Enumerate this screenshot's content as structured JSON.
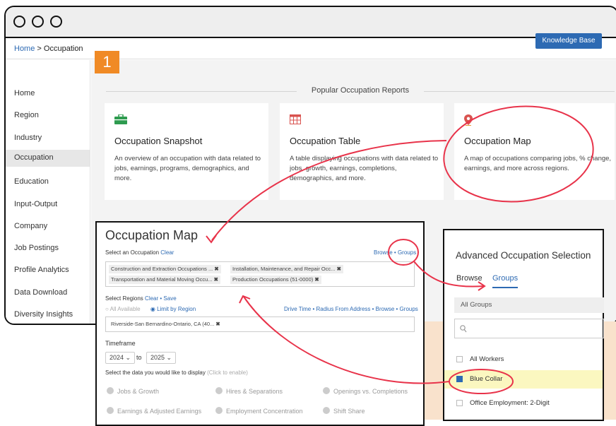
{
  "breadcrumb": {
    "home": "Home",
    "separator": ">",
    "current": "Occupation"
  },
  "header": {
    "knowledge_base": "Knowledge Base"
  },
  "step_badge": "1",
  "sidebar": {
    "items": [
      {
        "label": "Home"
      },
      {
        "label": "Region"
      },
      {
        "label": "Industry"
      },
      {
        "label": "Occupation"
      },
      {
        "label": "Education"
      },
      {
        "label": "Input-Output"
      },
      {
        "label": "Company"
      },
      {
        "label": "Job Postings"
      },
      {
        "label": "Profile Analytics"
      },
      {
        "label": "Data Download"
      },
      {
        "label": "Diversity Insights"
      }
    ],
    "active": "Occupation"
  },
  "popular": {
    "title": "Popular Occupation Reports",
    "cards": [
      {
        "icon": "briefcase-icon",
        "title": "Occupation Snapshot",
        "desc": "An overview of an occupation with data related to jobs, earnings, programs, demographics, and more."
      },
      {
        "icon": "table-icon",
        "title": "Occupation Table",
        "desc": "A table displaying occupations with data related to jobs, growth, earnings, completions, demographics, and more."
      },
      {
        "icon": "map-pin-icon",
        "title": "Occupation Map",
        "desc": "A map of occupations comparing jobs, % change, earnings, and more across regions."
      }
    ]
  },
  "map_panel": {
    "title": "Occupation Map",
    "select_occupation": "Select an Occupation",
    "clear": "Clear",
    "browse": "Browse",
    "groups": "Groups",
    "tags": [
      "Construction and Extraction Occupations ...",
      "Installation, Maintenance, and Repair Occ...",
      "Transportation and Material Moving Occu...",
      "Production Occupations (51-0000)"
    ],
    "select_regions": "Select Regions",
    "clear_save": "Clear • Save",
    "all_available": "All Available",
    "limit_by_region": "Limit by Region",
    "region_links": "Drive Time • Radius From Address • Browse • Groups",
    "region_tag": "Riverside-San Bernardino-Ontario, CA (40...",
    "timeframe": "Timeframe",
    "year_from": "2024",
    "to": "to",
    "year_to": "2025",
    "data_prompt": "Select the data you would like to display",
    "click_enable": "(Click to enable)",
    "options": [
      "Jobs & Growth",
      "Hires & Separations",
      "Openings vs. Completions",
      "Earnings & Adjusted Earnings",
      "Employment Concentration",
      "Shift Share"
    ]
  },
  "adv_panel": {
    "title": "Advanced Occupation Selection",
    "tab_browse": "Browse",
    "tab_groups": "Groups",
    "all_groups": "All Groups",
    "rows": [
      {
        "label": "All Workers",
        "checked": false
      },
      {
        "label": "Blue Collar",
        "checked": true
      },
      {
        "label": "Office Employment: 2-Digit",
        "checked": false
      }
    ]
  },
  "colors": {
    "accent": "#2d6ab3",
    "badge": "#f08a25",
    "highlight": "#fbf7c0",
    "annotation": "#e8334a"
  }
}
